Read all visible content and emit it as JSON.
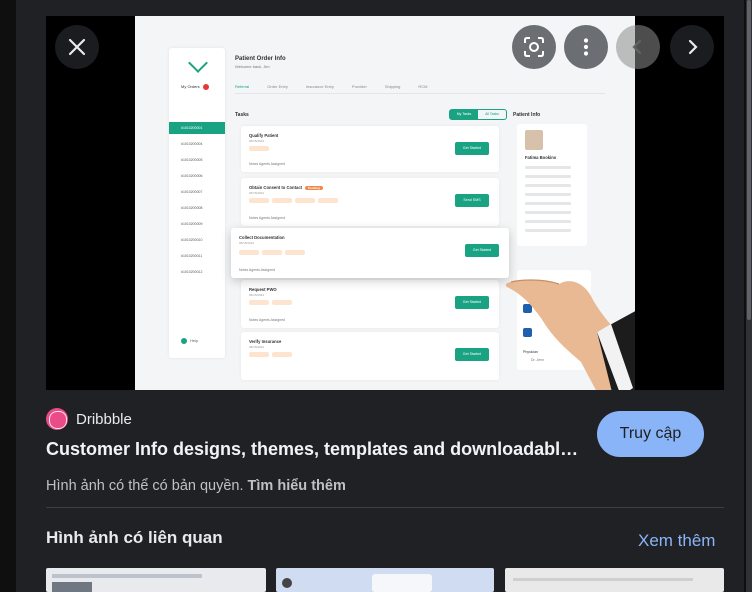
{
  "viewer": {
    "close_label": "Close",
    "lens_label": "Search inside image",
    "more_label": "More options",
    "prev_label": "Previous",
    "next_label": "Next"
  },
  "preview_image": {
    "app_title": "Patient Order Info",
    "welcome": "Welcome back, Jim",
    "sidebar_header": "My Orders",
    "orders": [
      "#1010200001",
      "#1010200004",
      "#1010200005",
      "#1010200006",
      "#1010200007",
      "#1010200008",
      "#1010200009",
      "#1010200010",
      "#1010200011",
      "#1010200012"
    ],
    "help": "Help",
    "steps": [
      "Referral",
      "Order Entry",
      "Insurance Entry",
      "Provider",
      "Shipping",
      "RCM"
    ],
    "tasks_heading": "Tasks",
    "task_tabs": [
      "My Tasks",
      "All Tasks"
    ],
    "tasks": [
      {
        "title": "Qualify Patient",
        "date": "06/15/2024",
        "pill": "",
        "meta": "Notes   Agents Assigned",
        "button": "Get Started"
      },
      {
        "title": "Obtain Consent to Contact",
        "date": "06/15/2024",
        "pill": "Pending",
        "meta": "Notes   Agents Assigned",
        "button": "Send SMS"
      },
      {
        "title": "Collect Documentation",
        "date": "06/15/2024",
        "pill": "",
        "meta": "Notes   Agents Assigned",
        "button": "Get Started"
      },
      {
        "title": "Request PWO",
        "date": "06/15/2024",
        "pill": "",
        "meta": "Notes   Agents Assigned",
        "button": "Get Started"
      },
      {
        "title": "Verify Insurance",
        "date": "06/15/2024",
        "pill": "",
        "meta": "Notes   Agents Assigned",
        "button": "Get Started"
      }
    ],
    "patient_info_heading": "Patient Info",
    "patient_name": "Fatima Bookins",
    "physician": "Physician",
    "physician_name": "Dr. Jenn"
  },
  "source": {
    "name": "Dribbble",
    "brand_color": "#ea4c89"
  },
  "result": {
    "title": "Customer Info designs, themes, templates and downloadable ...",
    "visit_label": "Truy cập",
    "copyright_text": "Hình ảnh có thể có bản quyền.",
    "learn_more": "Tìm hiểu thêm"
  },
  "related": {
    "heading": "Hình ảnh có liên quan",
    "see_more": "Xem thêm"
  },
  "colors": {
    "accent": "#8ab4f8",
    "panel": "#202124",
    "mock_primary": "#1aa383"
  }
}
